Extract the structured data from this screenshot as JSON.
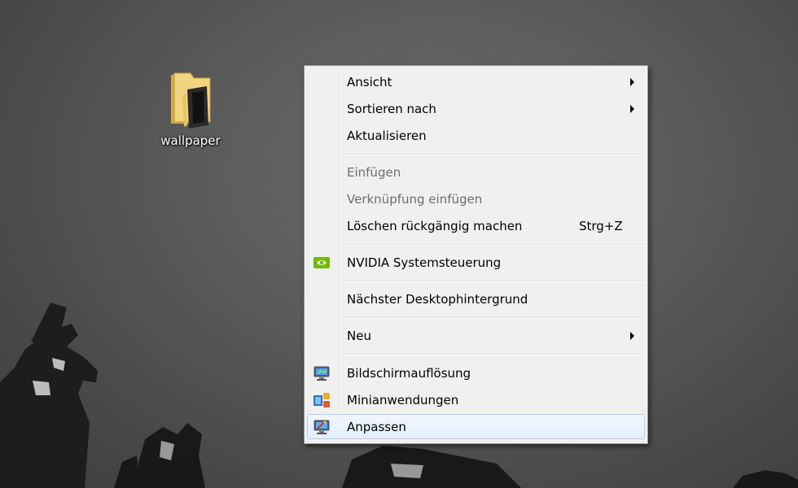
{
  "desktop": {
    "icons": [
      {
        "label": "wallpaper",
        "icon": "folder-icon",
        "folder_color": "#e9c766"
      }
    ]
  },
  "context_menu": {
    "items": [
      {
        "label": "Ansicht",
        "has_submenu": true
      },
      {
        "label": "Sortieren nach",
        "has_submenu": true
      },
      {
        "label": "Aktualisieren"
      },
      {
        "label": "Einfügen",
        "disabled": true
      },
      {
        "label": "Verknüpfung einfügen",
        "disabled": true
      },
      {
        "label": "Löschen rückgängig machen",
        "shortcut": "Strg+Z"
      },
      {
        "label": "NVIDIA Systemsteuerung",
        "icon": "nvidia-icon"
      },
      {
        "label": "Nächster Desktophintergrund"
      },
      {
        "label": "Neu",
        "has_submenu": true
      },
      {
        "label": "Bildschirmauflösung",
        "icon": "monitor-icon"
      },
      {
        "label": "Minianwendungen",
        "icon": "gadgets-icon"
      },
      {
        "label": "Anpassen",
        "icon": "personalize-icon",
        "highlighted": true
      }
    ],
    "colors": {
      "background": "#f0f0f0",
      "border": "#979797",
      "highlight_border": "#aecff7",
      "disabled_text": "#6d6d6d",
      "nvidia_green": "#76b900"
    }
  }
}
